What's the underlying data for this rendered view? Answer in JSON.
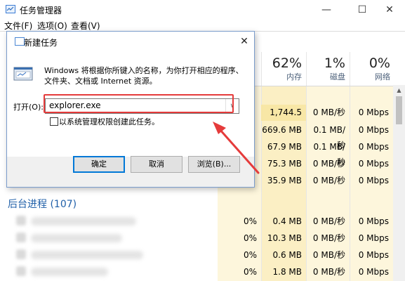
{
  "window": {
    "title": "任务管理器",
    "menu": [
      "文件(F)",
      "选项(O)",
      "查看(V)"
    ],
    "minimize_icon": "minimize-icon",
    "maximize_icon": "maximize-icon",
    "close_icon": "close-icon"
  },
  "columns": [
    {
      "pct": "62%",
      "label": "内存"
    },
    {
      "pct": "1%",
      "label": "磁盘"
    },
    {
      "pct": "0%",
      "label": "网络"
    }
  ],
  "app_rows": [
    {
      "memory": "1,744.5 ...",
      "disk": "0 MB/秒",
      "network": "0 Mbps"
    },
    {
      "memory": "669.6 MB",
      "disk": "0.1 MB/秒",
      "network": "0 Mbps"
    },
    {
      "memory": "67.9 MB",
      "disk": "0.1 MB/秒",
      "network": "0 Mbps"
    },
    {
      "memory": "75.3 MB",
      "disk": "0 MB/秒",
      "network": "0 Mbps"
    },
    {
      "memory": "35.9 MB",
      "disk": "0 MB/秒",
      "network": "0 Mbps"
    }
  ],
  "background_group": {
    "title": "后台进程 (107)"
  },
  "bg_rows": [
    {
      "cpu": "0%",
      "memory": "0.4 MB",
      "disk": "0 MB/秒",
      "network": "0 Mbps"
    },
    {
      "cpu": "0%",
      "memory": "10.3 MB",
      "disk": "0 MB/秒",
      "network": "0 Mbps"
    },
    {
      "cpu": "0%",
      "memory": "0.6 MB",
      "disk": "0 MB/秒",
      "network": "0 Mbps"
    },
    {
      "cpu": "0%",
      "memory": "1.8 MB",
      "disk": "0 MB/秒",
      "network": "0 Mbps"
    }
  ],
  "run_dialog": {
    "title": "新建任务",
    "description": "Windows 将根据你所键入的名称，为你打开相应的程序、文件夹、文档或 Internet 资源。",
    "open_label": "打开(O):",
    "open_value": "explorer.exe",
    "admin_checkbox_label": "以系统管理权限创建此任务。",
    "admin_checked": false,
    "buttons": {
      "ok": "确定",
      "cancel": "取消",
      "browse": "浏览(B)..."
    }
  },
  "colors": {
    "highlight": "#e53b3b",
    "memory_bg_strong": "#f8e7a6",
    "memory_bg": "#fbefc4",
    "cell_bg_light": "#fdf6dc",
    "group_title": "#1f5fa8",
    "primary_border": "#0078d7"
  }
}
